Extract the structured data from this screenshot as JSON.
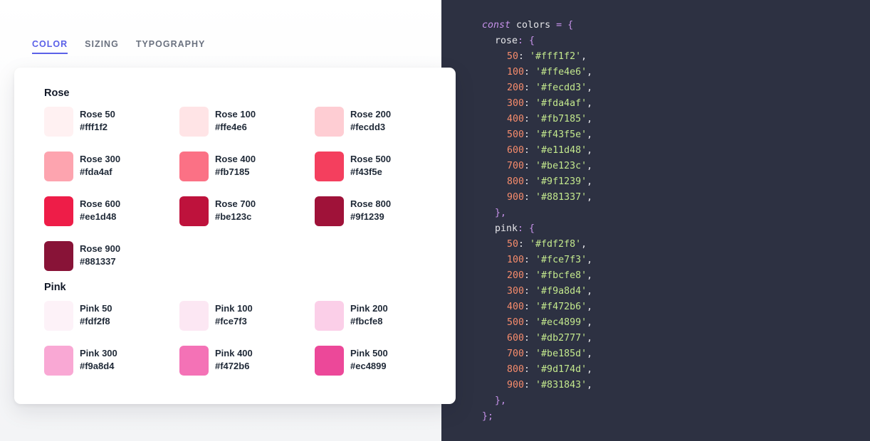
{
  "tabs": [
    {
      "label": "COLOR",
      "active": true
    },
    {
      "label": "SIZING",
      "active": false
    },
    {
      "label": "TYPOGRAPHY",
      "active": false
    }
  ],
  "groups": [
    {
      "title": "Rose",
      "swatches": [
        {
          "name": "Rose 50",
          "hex": "#fff1f2"
        },
        {
          "name": "Rose 100",
          "hex": "#ffe4e6"
        },
        {
          "name": "Rose 200",
          "hex": "#fecdd3"
        },
        {
          "name": "Rose 300",
          "hex": "#fda4af"
        },
        {
          "name": "Rose 400",
          "hex": "#fb7185"
        },
        {
          "name": "Rose 500",
          "hex": "#f43f5e"
        },
        {
          "name": "Rose 600",
          "hex": "#ee1d48"
        },
        {
          "name": "Rose 700",
          "hex": "#be123c"
        },
        {
          "name": "Rose 800",
          "hex": "#9f1239"
        },
        {
          "name": "Rose 900",
          "hex": "#881337"
        }
      ]
    },
    {
      "title": "Pink",
      "swatches": [
        {
          "name": "Pink 50",
          "hex": "#fdf2f8"
        },
        {
          "name": "Pink 100",
          "hex": "#fce7f3"
        },
        {
          "name": "Pink 200",
          "hex": "#fbcfe8"
        },
        {
          "name": "Pink 300",
          "hex": "#f9a8d4"
        },
        {
          "name": "Pink 400",
          "hex": "#f472b6"
        },
        {
          "name": "Pink 500",
          "hex": "#ec4899"
        }
      ]
    }
  ],
  "code": {
    "keyword": "const",
    "var": "colors",
    "open": "= {",
    "close": "};",
    "groups": [
      {
        "name": "rose",
        "entries": [
          {
            "k": "50",
            "v": "'#fff1f2'"
          },
          {
            "k": "100",
            "v": "'#ffe4e6'"
          },
          {
            "k": "200",
            "v": "'#fecdd3'"
          },
          {
            "k": "300",
            "v": "'#fda4af'"
          },
          {
            "k": "400",
            "v": "'#fb7185'"
          },
          {
            "k": "500",
            "v": "'#f43f5e'"
          },
          {
            "k": "600",
            "v": "'#e11d48'"
          },
          {
            "k": "700",
            "v": "'#be123c'"
          },
          {
            "k": "800",
            "v": "'#9f1239'"
          },
          {
            "k": "900",
            "v": "'#881337'"
          }
        ]
      },
      {
        "name": "pink",
        "entries": [
          {
            "k": "50",
            "v": "'#fdf2f8'"
          },
          {
            "k": "100",
            "v": "'#fce7f3'"
          },
          {
            "k": "200",
            "v": "'#fbcfe8'"
          },
          {
            "k": "300",
            "v": "'#f9a8d4'"
          },
          {
            "k": "400",
            "v": "'#f472b6'"
          },
          {
            "k": "500",
            "v": "'#ec4899'"
          },
          {
            "k": "600",
            "v": "'#db2777'"
          },
          {
            "k": "700",
            "v": "'#be185d'"
          },
          {
            "k": "800",
            "v": "'#9d174d'"
          },
          {
            "k": "900",
            "v": "'#831843'"
          }
        ]
      }
    ]
  }
}
